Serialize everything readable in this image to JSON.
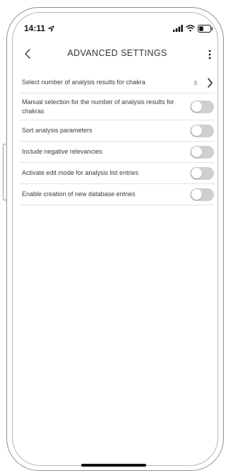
{
  "status_bar": {
    "time": "14:11",
    "icons": [
      "location-arrow-icon",
      "signal-icon",
      "wifi-icon",
      "battery-icon"
    ]
  },
  "nav": {
    "title": "ADVANCED SETTINGS",
    "back_icon": "chevron-left-icon",
    "more_icon": "more-vertical-icon"
  },
  "settings": [
    {
      "label": "Select number of analysis results for chakra",
      "value": "3",
      "type": "disclosure"
    },
    {
      "label": "Manual selection for the number of analysis results for chakras",
      "type": "toggle",
      "on": false
    },
    {
      "label": "Sort analysis parameters",
      "type": "toggle",
      "on": false
    },
    {
      "label": "Include negative relevancies",
      "type": "toggle",
      "on": false
    },
    {
      "label": "Activate edit mode for analysis list entries",
      "type": "toggle",
      "on": false
    },
    {
      "label": "Enable creation of new database entries",
      "type": "toggle",
      "on": false
    }
  ],
  "colors": {
    "toggle_off": "#cfcfcf",
    "divider": "#e2e2e2",
    "text": "#3c3c3c"
  }
}
